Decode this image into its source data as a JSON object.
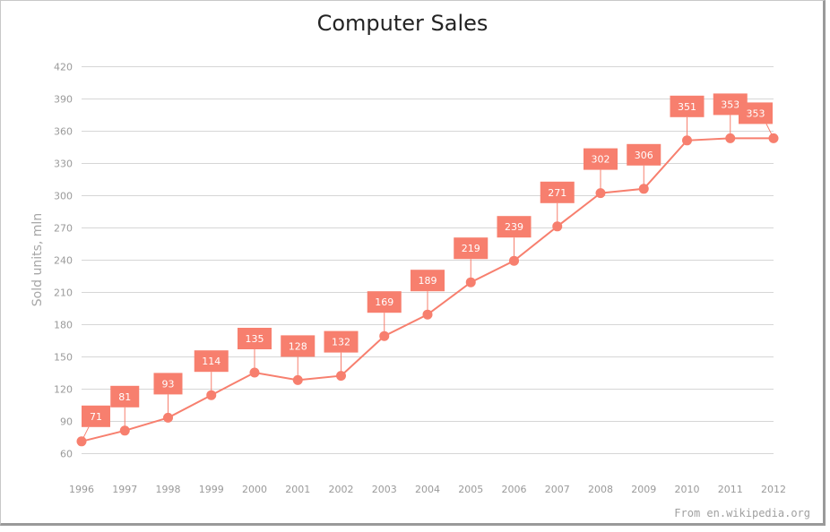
{
  "chart_data": {
    "type": "line",
    "title": "Computer  Sales",
    "xlabel": "",
    "ylabel": "Sold units, mln",
    "categories": [
      "1996",
      "1997",
      "1998",
      "1999",
      "2000",
      "2001",
      "2002",
      "2003",
      "2004",
      "2005",
      "2006",
      "2007",
      "2008",
      "2009",
      "2010",
      "2011",
      "2012"
    ],
    "series": [
      {
        "name": "Computer Sales",
        "values": [
          71,
          81,
          93,
          114,
          135,
          128,
          132,
          169,
          189,
          219,
          239,
          271,
          302,
          306,
          351,
          353,
          353
        ],
        "color": "#f77f6e"
      }
    ],
    "ylim": [
      60,
      420
    ],
    "yticks": [
      60,
      90,
      120,
      150,
      180,
      210,
      240,
      270,
      300,
      330,
      360,
      390,
      420
    ],
    "grid": true,
    "legend": "none",
    "data_labels": true,
    "source_note": "From en.wikipedia.org"
  },
  "colors": {
    "series": "#f77f6e",
    "grid": "#d6d6d6",
    "tick_text": "#9a9a9a",
    "title_text": "#232323"
  }
}
